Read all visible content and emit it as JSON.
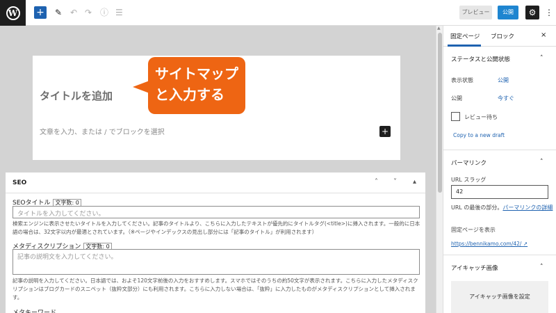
{
  "toolbar": {
    "logo_letter": "W",
    "add_symbol": "+",
    "pen_symbol": "✎",
    "undo_symbol": "↶",
    "redo_symbol": "↷",
    "info_symbol": "ⓘ",
    "list_symbol": "☰",
    "preview_label": "プレビュー",
    "publish_label": "公開",
    "settings_symbol": "⚙",
    "more_symbol": "⋮"
  },
  "editor": {
    "title_placeholder": "タイトルを追加",
    "paragraph_placeholder": "文章を入力、または / でブロックを選択",
    "block_add_symbol": "+",
    "callout_line1": "サイトマップ",
    "callout_line2": "と入力する"
  },
  "seo": {
    "heading": "SEO",
    "title_label": "SEOタイトル",
    "title_count": "文字数: 0",
    "title_placeholder": "タイトルを入力してください。",
    "title_help": "検索エンジンに表示させたいタイトルを入力してください。記事のタイトルより、こちらに入力したテキストが優先的にタイトルタグ(<title>)に挿入されます。一般的に日本語の場合は、32文字以内が最適とされています。（※ページやインデックスの見出し部分には「記事のタイトル」が利用されます）",
    "desc_label": "メタディスクリプション",
    "desc_count": "文字数: 0",
    "desc_placeholder": "記事の説明文を入力してください。",
    "desc_help": "記事の説明を入力してください。日本語では、およそ120文字前後の入力をおすすめします。スマホではそのうちの約50文字が表示されます。こちらに入力したメタディスクリプションはブログカードのスニペット（抜粋文部分）にも利用されます。こちらに入力しない場合は、「抜粋」に入力したものがメタディスクリプションとして挿入されます。",
    "keyword_label": "メタキーワード",
    "ctl_up": "˄",
    "ctl_down": "˅",
    "ctl_toggle": "▴"
  },
  "sidebar": {
    "tab_page": "固定ページ",
    "tab_block": "ブロック",
    "close_symbol": "×",
    "status_section": "ステータスと公開状態",
    "visibility_label": "表示状態",
    "visibility_value": "公開",
    "publish_label": "公開",
    "publish_value": "今すぐ",
    "pending_label": "レビュー待ち",
    "copy_draft": "Copy to a new draft",
    "permalink_section": "パーマリンク",
    "slug_label": "URL スラッグ",
    "slug_value": "42",
    "slug_hint_prefix": "URL の最後の部分。",
    "slug_hint_link": "パーマリンクの詳細",
    "view_page_label": "固定ページを表示",
    "page_url": "https://bennikamo.com/42/",
    "eyecatch_section": "アイキャッチ画像",
    "eyecatch_button": "アイキャッチ画像を設定",
    "chevron_up": "˄"
  }
}
